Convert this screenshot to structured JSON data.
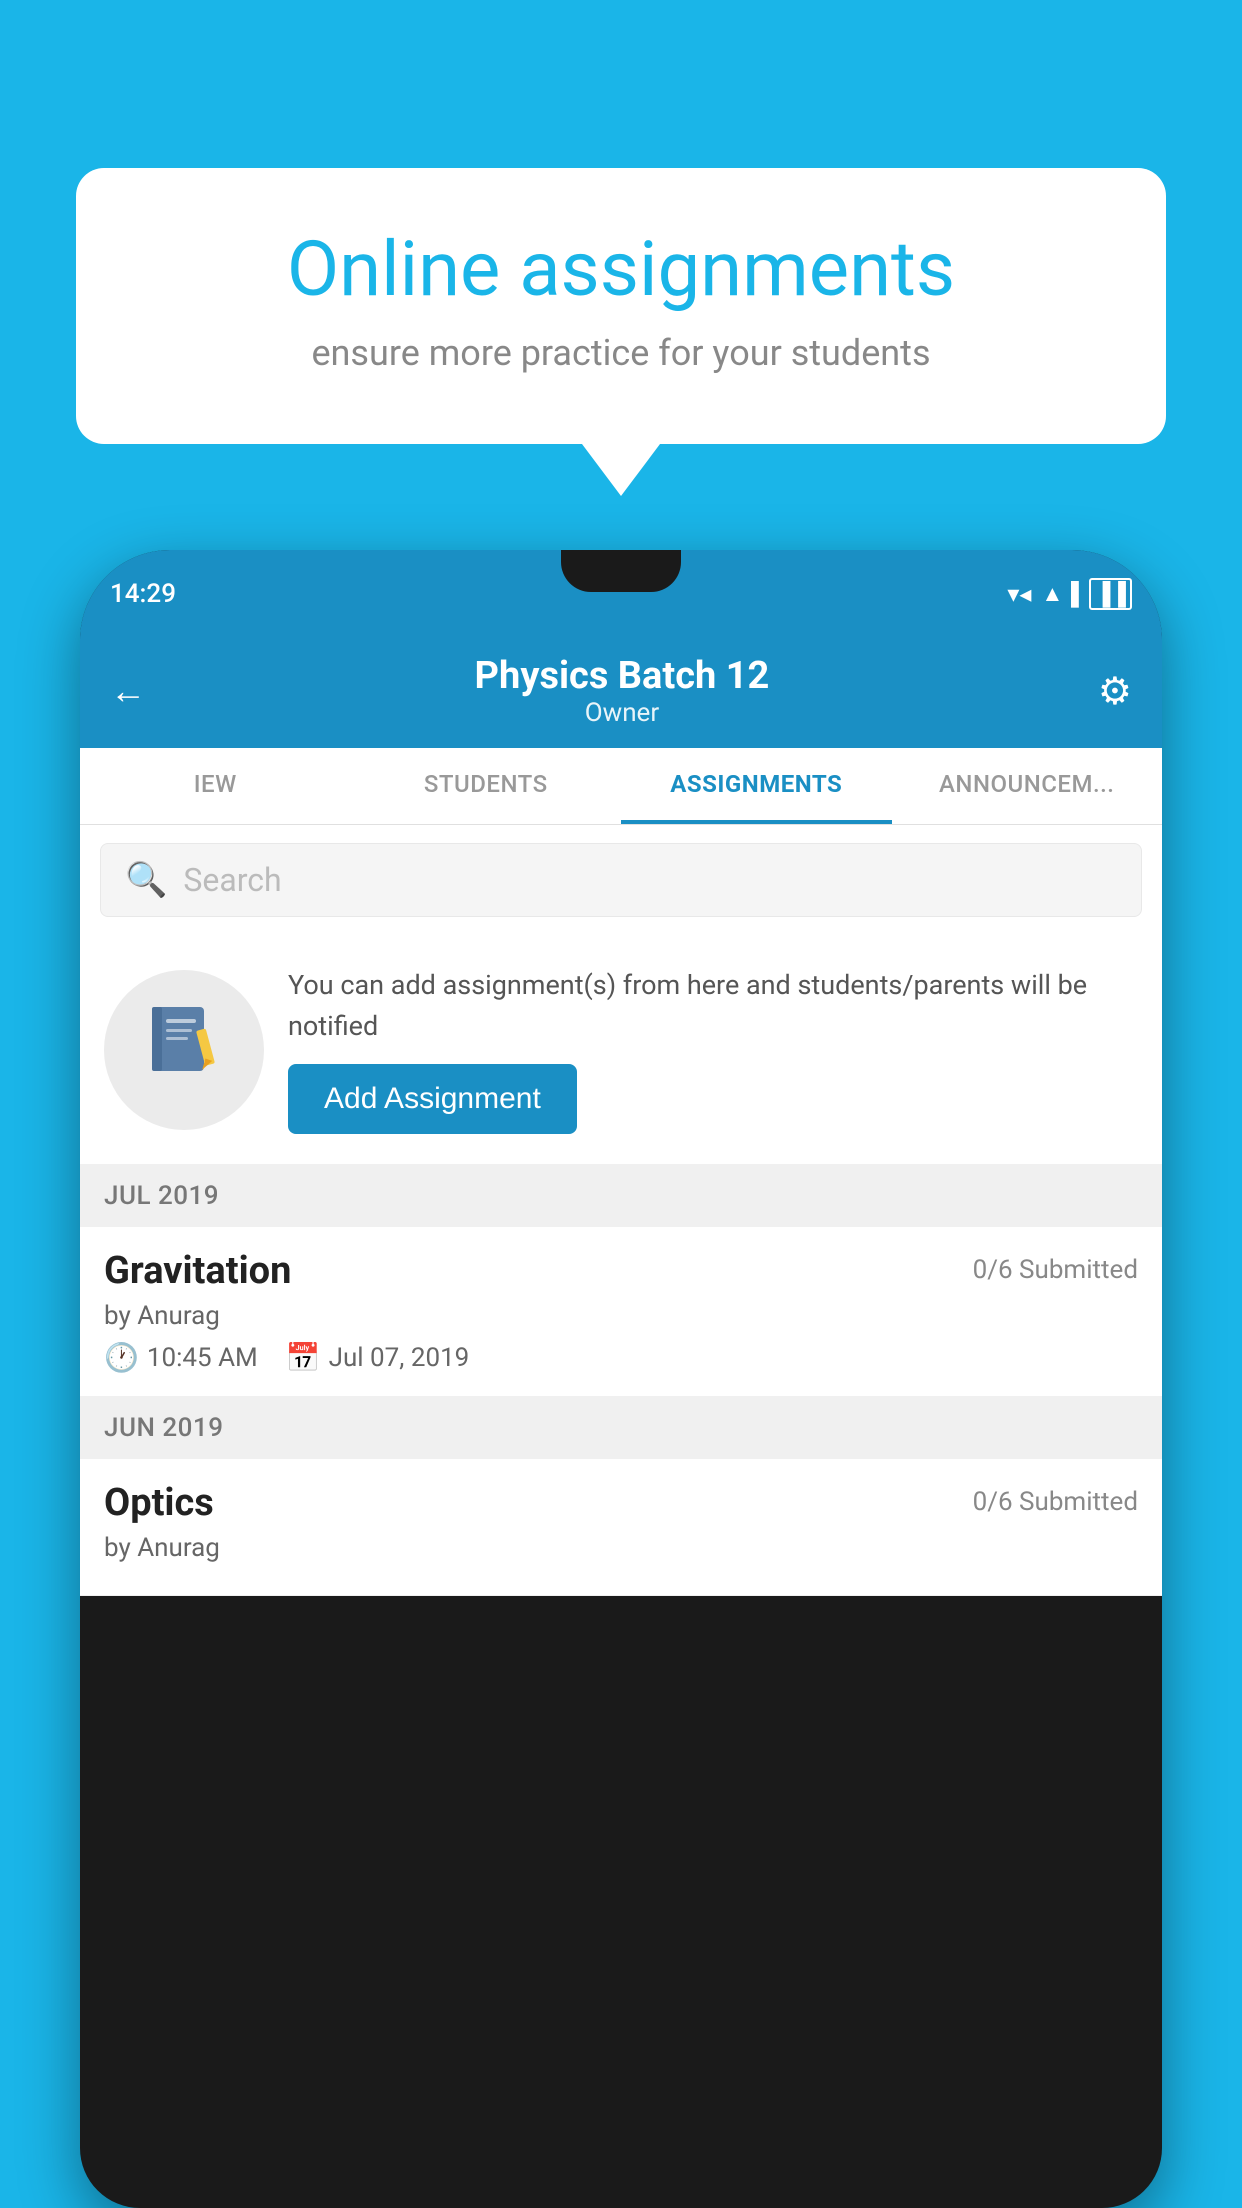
{
  "background_color": "#1ab5e8",
  "speech_bubble": {
    "title": "Online assignments",
    "subtitle": "ensure more practice for your students"
  },
  "phone": {
    "status_bar": {
      "time": "14:29",
      "wifi": "▼",
      "signal": "▲",
      "battery": "▐"
    },
    "header": {
      "title": "Physics Batch 12",
      "subtitle": "Owner",
      "back_label": "←",
      "settings_label": "⚙"
    },
    "tabs": [
      {
        "label": "IEW",
        "active": false
      },
      {
        "label": "STUDENTS",
        "active": false
      },
      {
        "label": "ASSIGNMENTS",
        "active": true
      },
      {
        "label": "ANNOUNCEM...",
        "active": false
      }
    ],
    "search": {
      "placeholder": "Search",
      "icon": "🔍"
    },
    "promo": {
      "description": "You can add assignment(s) from here and students/parents will be notified",
      "button_label": "Add Assignment"
    },
    "sections": [
      {
        "header": "JUL 2019",
        "assignments": [
          {
            "name": "Gravitation",
            "submitted": "0/6 Submitted",
            "by": "by Anurag",
            "time": "10:45 AM",
            "date": "Jul 07, 2019"
          }
        ]
      },
      {
        "header": "JUN 2019",
        "assignments": [
          {
            "name": "Optics",
            "submitted": "0/6 Submitted",
            "by": "by Anurag",
            "time": "",
            "date": ""
          }
        ]
      }
    ]
  }
}
